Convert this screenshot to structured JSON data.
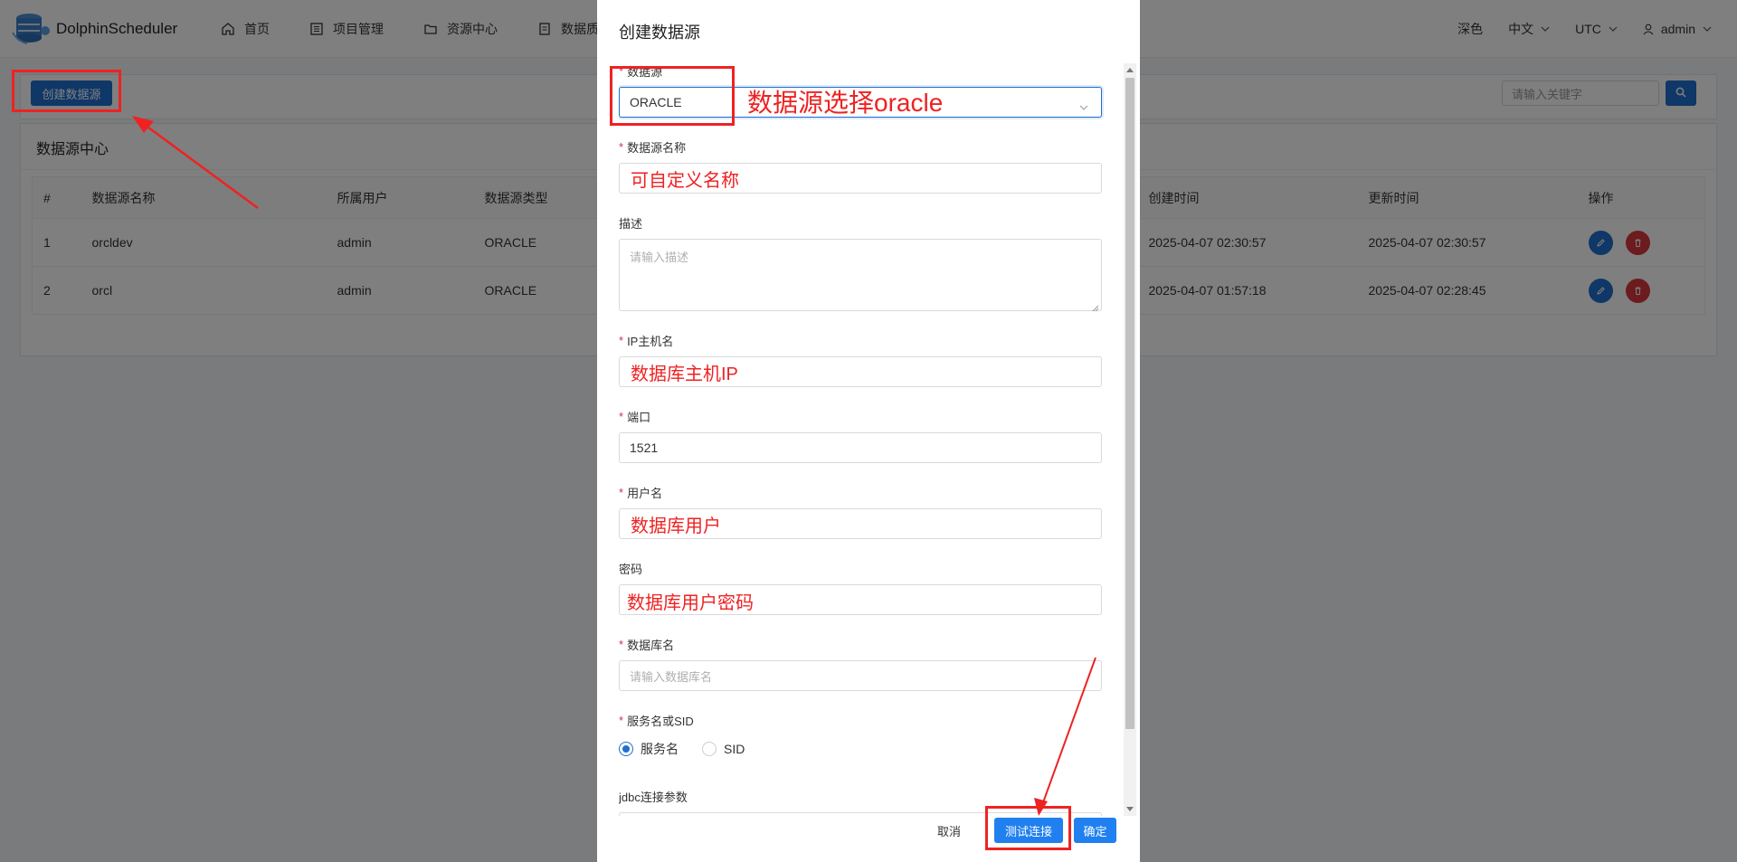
{
  "app": {
    "name": "DolphinScheduler"
  },
  "nav": {
    "items": [
      {
        "label": "首页",
        "icon": "home-icon"
      },
      {
        "label": "项目管理",
        "icon": "project-list-icon"
      },
      {
        "label": "资源中心",
        "icon": "folder-icon"
      },
      {
        "label": "数据质量",
        "icon": "document-icon"
      }
    ],
    "theme": "深色",
    "language": "中文",
    "timezone": "UTC",
    "user": "admin"
  },
  "toolbar": {
    "create_label": "创建数据源",
    "search_placeholder": "请输入关键字"
  },
  "panel": {
    "title": "数据源中心",
    "columns": [
      "#",
      "数据源名称",
      "所属用户",
      "数据源类型",
      "创建时间",
      "更新时间",
      "操作"
    ],
    "rows": [
      {
        "index": "1",
        "name": "orcldev",
        "user": "admin",
        "type": "ORACLE",
        "created": "2025-04-07 02:30:57",
        "updated": "2025-04-07 02:30:57"
      },
      {
        "index": "2",
        "name": "orcl",
        "user": "admin",
        "type": "ORACLE",
        "created": "2025-04-07 01:57:18",
        "updated": "2025-04-07 02:28:45"
      }
    ]
  },
  "modal": {
    "title": "创建数据源",
    "fields": {
      "type_label": "数据源",
      "type_value": "ORACLE",
      "name_label": "数据源名称",
      "desc_label": "描述",
      "desc_placeholder": "请输入描述",
      "host_label": "IP主机名",
      "port_label": "端口",
      "port_value": "1521",
      "user_label": "用户名",
      "password_label": "密码",
      "db_label": "数据库名",
      "db_placeholder": "请输入数据库名",
      "service_label": "服务名或SID",
      "service_option": "服务名",
      "sid_option": "SID",
      "jdbc_label": "jdbc连接参数"
    },
    "footer": {
      "cancel": "取消",
      "test": "测试连接",
      "ok": "确定"
    }
  },
  "annotations": {
    "select_oracle": "数据源选择oracle",
    "custom_name": "可自定义名称",
    "host_ip": "数据库主机IP",
    "db_user": "数据库用户",
    "db_password": "数据库用户密码",
    "color": "#ee2222"
  },
  "colors": {
    "primary": "#1f6fcf",
    "danger": "#d9363e",
    "accent": "#2080f0"
  }
}
